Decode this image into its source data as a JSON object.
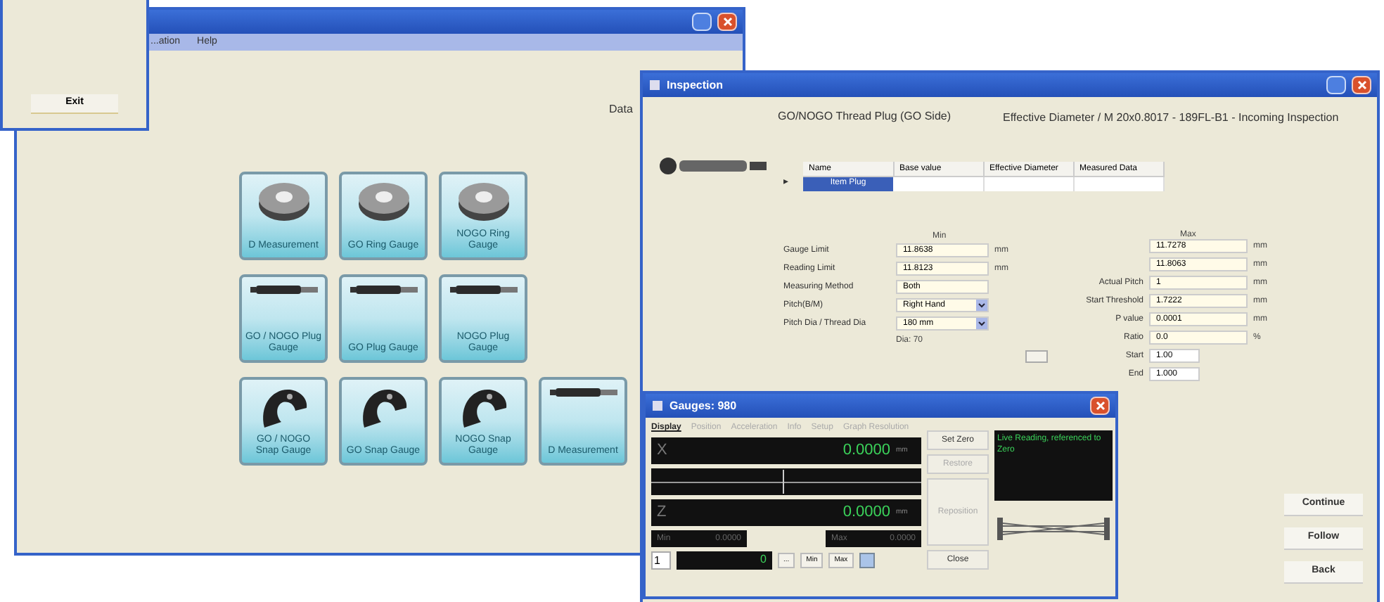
{
  "exit_dialog": {
    "button": "Exit"
  },
  "main_window": {
    "menu": [
      "...ation",
      "Help"
    ],
    "status_label": "Data",
    "tile_rows": [
      [
        {
          "label": "D Measurement",
          "kind": "ring"
        },
        {
          "label": "GO Ring Gauge",
          "kind": "ring"
        },
        {
          "label": "NOGO Ring Gauge",
          "kind": "ring"
        }
      ],
      [
        {
          "label": "GO / NOGO Plug Gauge",
          "kind": "plug"
        },
        {
          "label": "GO Plug Gauge",
          "kind": "plug"
        },
        {
          "label": "NOGO Plug Gauge",
          "kind": "plug"
        }
      ],
      [
        {
          "label": "GO / NOGO Snap Gauge",
          "kind": "snap"
        },
        {
          "label": "GO Snap Gauge",
          "kind": "snap"
        },
        {
          "label": "NOGO Snap Gauge",
          "kind": "snap"
        },
        {
          "label": "D Measurement",
          "kind": "plug"
        }
      ]
    ]
  },
  "inspection_window": {
    "title": "Inspection",
    "heading": "GO/NOGO Thread Plug (GO Side)",
    "subheading": "Effective Diameter / M 20x0.8017 - 189FL-B1 - Incoming Inspection",
    "table": {
      "columns": [
        "Name",
        "Base value",
        "Effective Diameter",
        "Measured Data"
      ],
      "rows": [
        {
          "marker": "▸",
          "cells": [
            "Item Plug"
          ],
          "selected": true
        }
      ]
    },
    "left_header": "Min",
    "left_fields": [
      {
        "label": "Gauge Limit",
        "value": "11.8638",
        "unit": "mm",
        "kind": "text"
      },
      {
        "label": "Reading Limit",
        "value": "11.8123",
        "unit": "mm",
        "kind": "text"
      },
      {
        "label": "Measuring Method",
        "value": "Both",
        "kind": "text"
      },
      {
        "label": "Pitch(B/M)",
        "value": "Right Hand",
        "kind": "dropdown"
      },
      {
        "label": "Pitch Dia / Thread Dia",
        "value": "180 mm",
        "kind": "dropdown"
      }
    ],
    "left_note": "Dia: 70",
    "right_header": "Max",
    "right_fields": [
      {
        "value": "11.7278",
        "unit": "mm"
      },
      {
        "value": "11.8063",
        "unit": "mm"
      },
      {
        "label": "Actual Pitch",
        "value": "1",
        "unit": "mm"
      },
      {
        "label": "Start Threshold",
        "value": "1.7222",
        "unit": "mm"
      },
      {
        "label": "P value",
        "value": "0.0001",
        "unit": "mm"
      },
      {
        "label": "Ratio",
        "value": "0.0",
        "unit": "%"
      }
    ],
    "small_fields": [
      {
        "label": "Start",
        "value": "1.00"
      },
      {
        "label": "End",
        "value": "1.000"
      }
    ],
    "buttons": [
      "Continue",
      "Follow",
      "Back"
    ]
  },
  "gauge_window": {
    "title": "Gauges: 980",
    "tabs": [
      {
        "label": "Display",
        "selected": true
      },
      {
        "label": "Position",
        "selected": false
      },
      {
        "label": "Acceleration",
        "selected": false
      },
      {
        "label": "Info",
        "selected": false
      },
      {
        "label": "Setup",
        "selected": false
      },
      {
        "label": "Graph Resolution",
        "selected": false
      }
    ],
    "readouts": [
      {
        "axis": "X",
        "value": "0.0000",
        "unit": "mm"
      },
      {
        "axis": "Z",
        "value": "0.0000",
        "unit": "mm"
      }
    ],
    "min": {
      "label": "Min",
      "value": "0.0000"
    },
    "max": {
      "label": "Max",
      "value": "0.0000"
    },
    "spinner": "1",
    "counter": "0",
    "small_buttons": [
      "...",
      "Min",
      "Max"
    ],
    "side_buttons": [
      "Set Zero",
      "Restore",
      "Reposition",
      "Close"
    ],
    "message": "Live Reading, referenced to Zero"
  }
}
